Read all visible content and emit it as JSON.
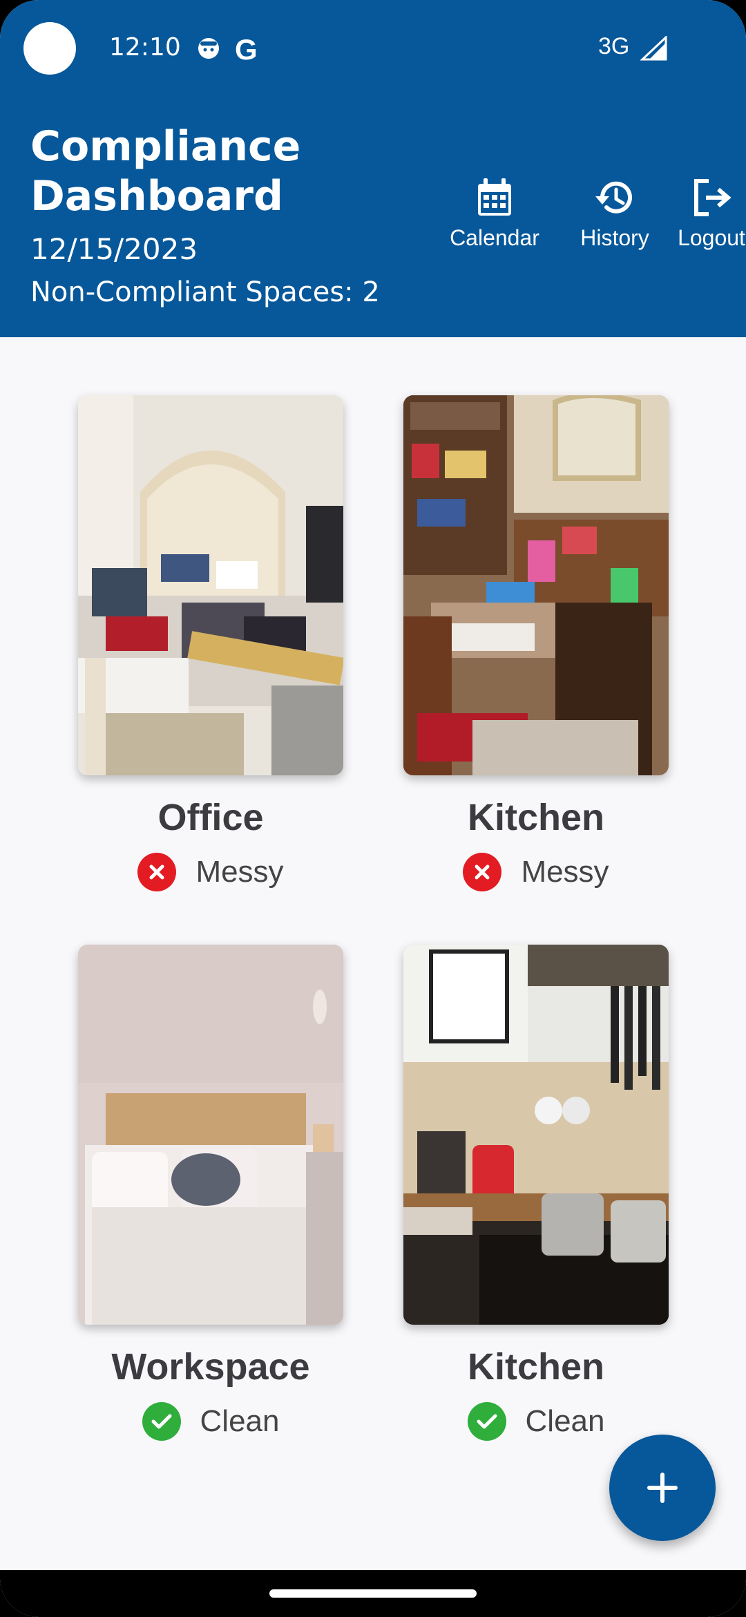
{
  "status_bar": {
    "time": "12:10",
    "network": "3G",
    "g_icon": "G"
  },
  "header": {
    "title": "Compliance Dashboard",
    "date": "12/15/2023",
    "non_compliant": "Non-Compliant Spaces: 2",
    "actions": [
      {
        "label": "Calendar",
        "icon": "calendar-icon"
      },
      {
        "label": "History",
        "icon": "history-icon"
      },
      {
        "label": "Logout",
        "icon": "logout-icon"
      }
    ]
  },
  "spaces": [
    {
      "name": "Office",
      "status": "Messy",
      "status_color": "#e31b23"
    },
    {
      "name": "Kitchen",
      "status": "Messy",
      "status_color": "#e31b23"
    },
    {
      "name": "Workspace",
      "status": "Clean",
      "status_color": "#2fae3c"
    },
    {
      "name": "Kitchen",
      "status": "Clean",
      "status_color": "#2fae3c"
    }
  ],
  "colors": {
    "primary": "#07589a",
    "background": "#f8f8fb"
  }
}
